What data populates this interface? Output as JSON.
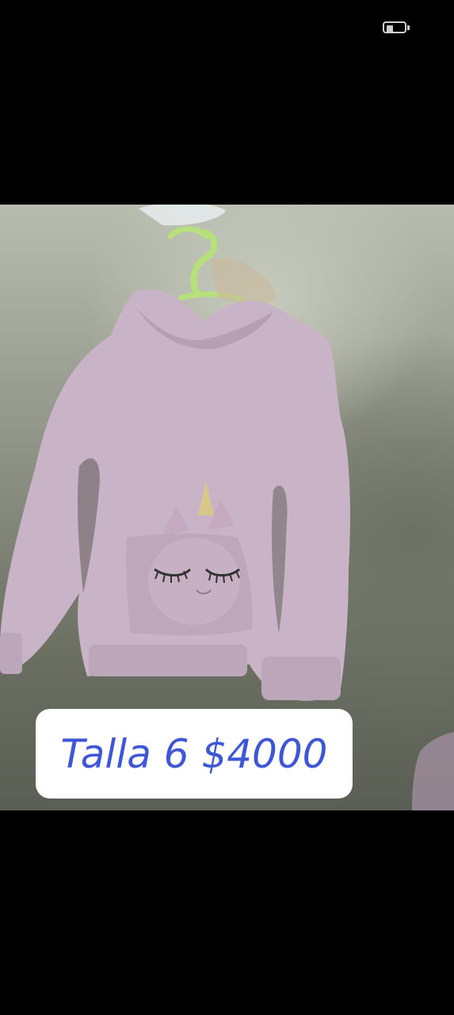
{
  "status_bar": {
    "battery_icon": "battery-low-icon",
    "battery_level": 0.35,
    "icon_color": "#cfcfcf"
  },
  "photo": {
    "subject_icon": "hoodie-image",
    "caption": "Talla 6 $4000",
    "caption_color": "#3d57d6",
    "caption_background": "#ffffff"
  }
}
